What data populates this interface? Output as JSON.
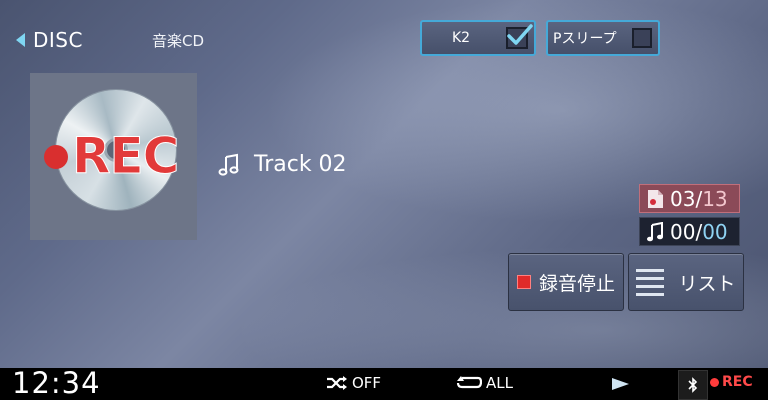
{
  "header": {
    "back_label": "DISC",
    "source_type": "音楽CD",
    "k2": {
      "label": "K2",
      "checked": true
    },
    "p_sleep": {
      "label": "Pスリープ",
      "checked": false
    }
  },
  "album_art": {
    "overlay_text": "REC"
  },
  "track": {
    "title": "Track 02"
  },
  "counters": {
    "track": {
      "current": "03",
      "separator": "/",
      "total": "13"
    },
    "recorded": {
      "current": "00",
      "separator": "/",
      "total": "00"
    }
  },
  "actions": {
    "stop_recording": "録音停止",
    "list": "リスト"
  },
  "status_bar": {
    "clock": "12:34",
    "shuffle": "OFF",
    "repeat": "ALL",
    "rec_label": "REC"
  },
  "colors": {
    "accent_cyan": "#45a9d8",
    "rec_red": "#e02a2a",
    "track_counter_bg": "#8b4a58"
  },
  "icons": [
    "back-arrow-icon",
    "checkmark-icon",
    "music-note-icon",
    "track-file-icon",
    "stop-icon",
    "list-icon",
    "shuffle-icon",
    "repeat-icon",
    "play-icon",
    "bluetooth-icon",
    "rec-dot-icon"
  ]
}
